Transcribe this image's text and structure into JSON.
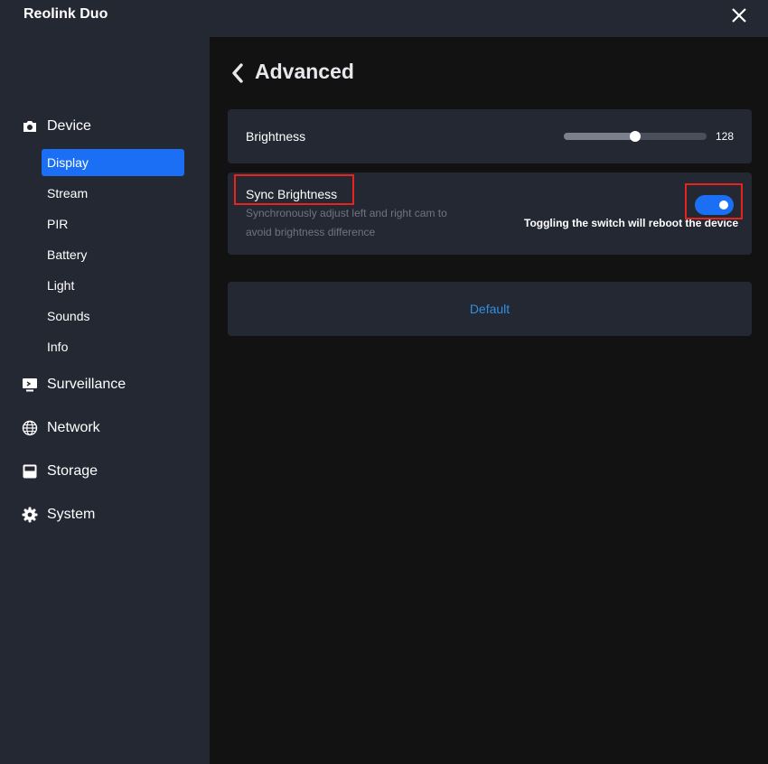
{
  "window": {
    "title": "Reolink Duo"
  },
  "sidebar": {
    "groups": [
      {
        "label": "Device",
        "icon": "camera-icon"
      },
      {
        "label": "Surveillance",
        "icon": "monitor-icon"
      },
      {
        "label": "Network",
        "icon": "globe-icon"
      },
      {
        "label": "Storage",
        "icon": "hard-drive-icon"
      },
      {
        "label": "System",
        "icon": "gear-icon"
      }
    ],
    "device_items": [
      {
        "label": "Display",
        "active": true
      },
      {
        "label": "Stream"
      },
      {
        "label": "PIR"
      },
      {
        "label": "Battery"
      },
      {
        "label": "Light"
      },
      {
        "label": "Sounds"
      },
      {
        "label": "Info"
      }
    ]
  },
  "page": {
    "title": "Advanced"
  },
  "brightness": {
    "label": "Brightness",
    "value": "128",
    "max": 255
  },
  "sync": {
    "label": "Sync Brightness",
    "description": "Synchronously adjust left and right cam to avoid brightness difference",
    "enabled": true,
    "note": "Toggling the switch will reboot the device"
  },
  "actions": {
    "default_label": "Default"
  },
  "colors": {
    "accent": "#1a6ff5",
    "highlight": "#e8231d",
    "link": "#2f8fe0"
  }
}
